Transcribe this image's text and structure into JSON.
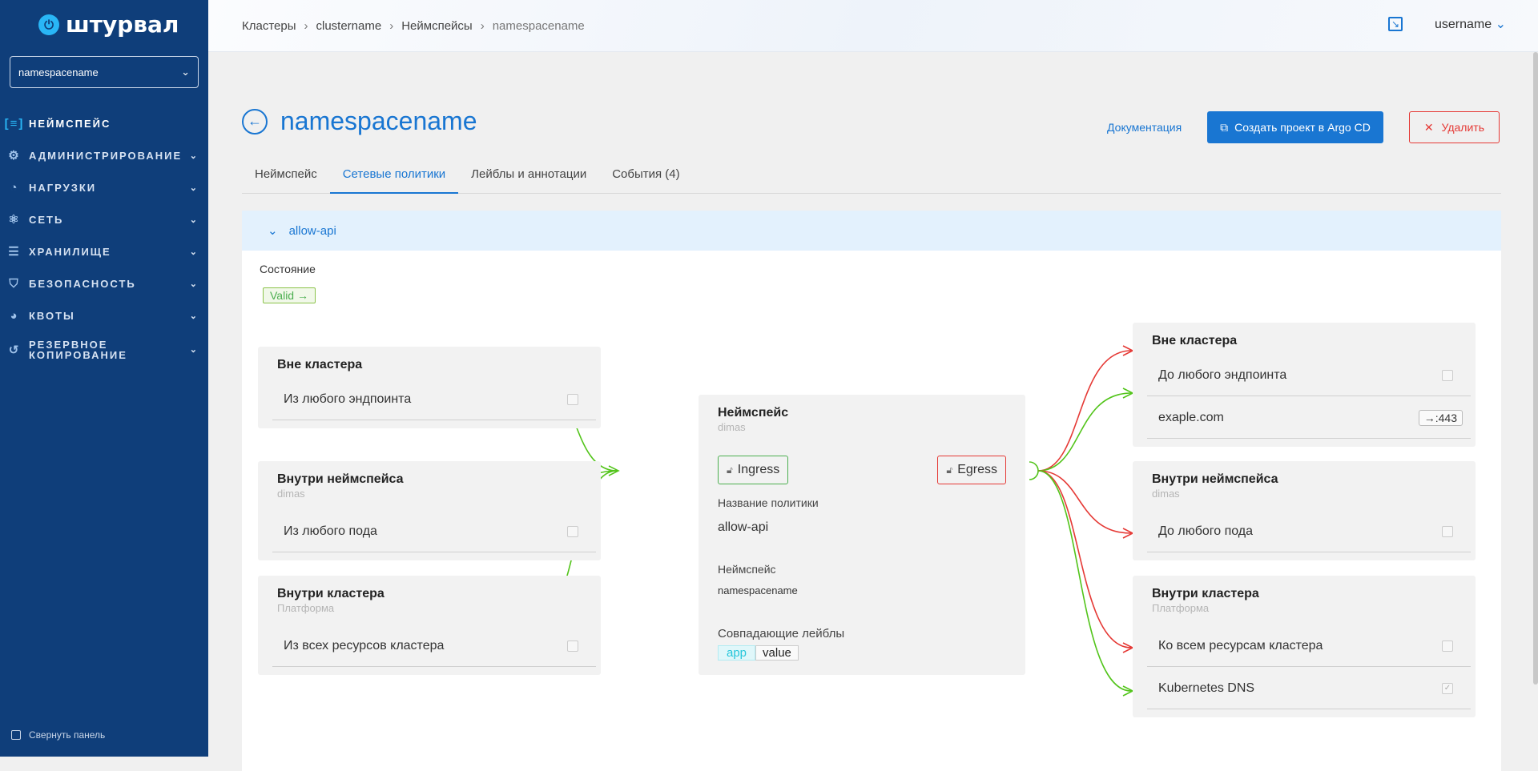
{
  "app": {
    "logo": "штурвал"
  },
  "sidebar": {
    "namespace_select": "namespacename",
    "items": [
      {
        "label": "НЕЙМСПЕЙС",
        "icon": "namespace-icon",
        "glyph": "[≡]",
        "active": true,
        "chevron": false
      },
      {
        "label": "АДМИНИСТРИРОВАНИЕ",
        "icon": "gear-icon",
        "glyph": "⚙",
        "chevron": true
      },
      {
        "label": "НАГРУЗКИ",
        "icon": "gauge-icon",
        "glyph": "◔",
        "chevron": true
      },
      {
        "label": "СЕТЬ",
        "icon": "network-icon",
        "glyph": "⚛",
        "chevron": true
      },
      {
        "label": "ХРАНИЛИЩЕ",
        "icon": "database-icon",
        "glyph": "☰",
        "chevron": true
      },
      {
        "label": "БЕЗОПАСНОСТЬ",
        "icon": "shield-icon",
        "glyph": "⛉",
        "chevron": true
      },
      {
        "label": "КВОТЫ",
        "icon": "pie-icon",
        "glyph": "◕",
        "chevron": true
      },
      {
        "label": "РЕЗЕРВНОЕ КОПИРОВАНИЕ",
        "icon": "backup-icon",
        "glyph": "↺",
        "chevron": true
      }
    ],
    "collapse_label": "Свернуть панель"
  },
  "header": {
    "breadcrumbs": [
      "Кластеры",
      "clustername",
      "Неймспейсы",
      "namespacename"
    ],
    "username": "username"
  },
  "page": {
    "title": "namespacename",
    "doc_link": "Документация",
    "argo_button": "Создать проект в Argo CD",
    "delete_button": "Удалить",
    "tabs": [
      "Неймспейс",
      "Сетевые политики",
      "Лейблы и аннотации",
      "События (4)"
    ],
    "active_tab": 1
  },
  "policy": {
    "name": "allow-api",
    "state_label": "Состояние",
    "state_value": "Valid",
    "ingress_sources": {
      "outside": {
        "title": "Вне кластера",
        "row": "Из любого эндпоинта"
      },
      "namespace": {
        "title": "Внутри неймспейса",
        "sub": "dimas",
        "row": "Из любого пода"
      },
      "cluster": {
        "title": "Внутри кластера",
        "sub": "Платформа",
        "row": "Из всех ресурсов кластера"
      }
    },
    "center": {
      "title": "Неймспейс",
      "sub": "dimas",
      "ingress": "Ingress",
      "egress": "Egress",
      "policy_name_label": "Название политики",
      "policy_name": "allow-api",
      "namespace_label": "Неймспейс",
      "namespace": "namespacename",
      "labels_label": "Совпадающие лейблы",
      "label_key": "app",
      "label_value": "value"
    },
    "egress_targets": {
      "outside": {
        "title": "Вне кластера",
        "row1": "До любого эндпоинта",
        "row2": "exaple.com",
        "row2_port": "→:443"
      },
      "namespace": {
        "title": "Внутри неймспейса",
        "sub": "dimas",
        "row": "До любого пода"
      },
      "cluster": {
        "title": "Внутри кластера",
        "sub": "Платформа",
        "row1": "Ко всем ресурсам кластера",
        "row2": "Kubernetes DNS"
      }
    }
  },
  "colors": {
    "allow": "#52c41a",
    "deny": "#e53935",
    "accent": "#1976d2",
    "sidebar": "#0f3e7a"
  }
}
